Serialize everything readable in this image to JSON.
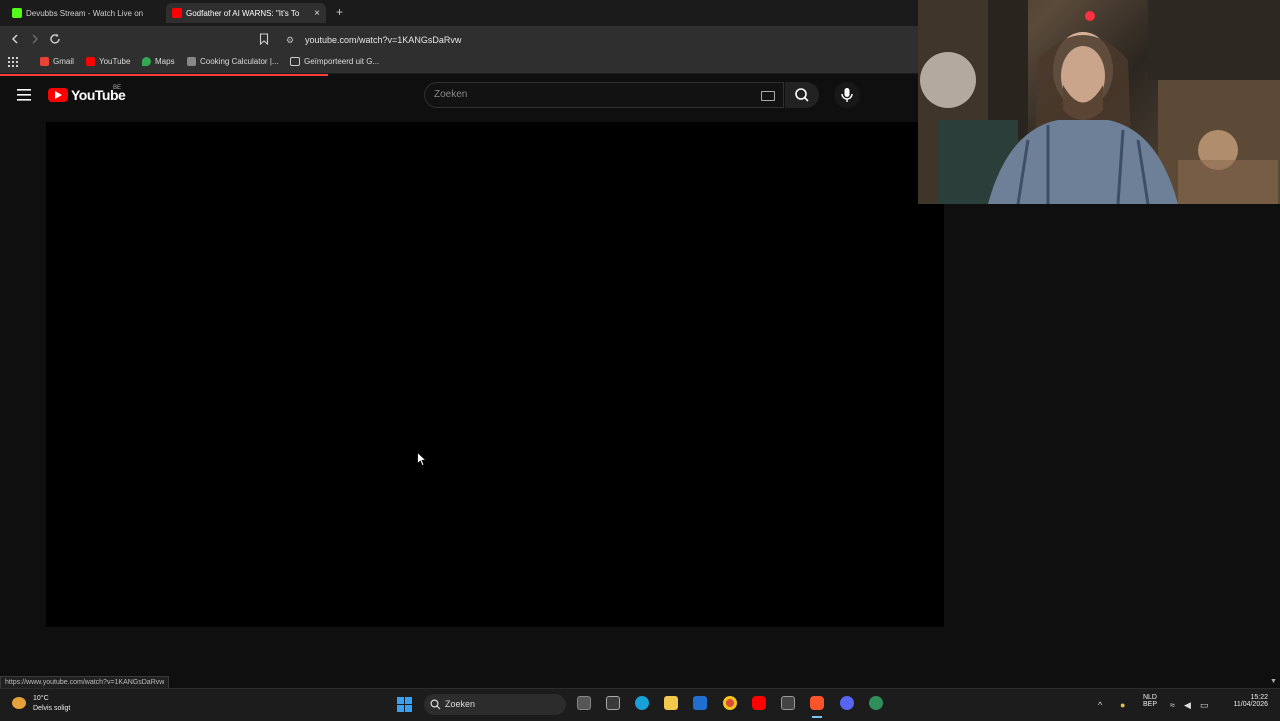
{
  "browser": {
    "tabs": [
      {
        "title": "Devubbs Stream - Watch Live on",
        "active": false,
        "favicon_color": "#53fc18"
      },
      {
        "title": "Godfather of AI WARNS: \"It's To",
        "active": true,
        "favicon_color": "#ff0000"
      }
    ],
    "new_tab": "+",
    "close_tab": "×",
    "url": "youtube.com/watch?v=1KANGsDaRvw",
    "bookmarks": [
      {
        "label": "Gmail",
        "color": "#ea4335"
      },
      {
        "label": "YouTube",
        "color": "#ff0000"
      },
      {
        "label": "Maps",
        "color": "#34a853"
      },
      {
        "label": "Cooking Calculator |...",
        "color": "#888888"
      },
      {
        "label": "Geïmporteerd uit G...",
        "color": "#cccccc"
      }
    ],
    "status_url": "https://www.youtube.com/watch?v=1KANGsDaRvw"
  },
  "youtube": {
    "logo_text": "YouTube",
    "country_code": "BE",
    "search_placeholder": "Zoeken"
  },
  "taskbar": {
    "weather_temp": "10°C",
    "weather_desc": "Delvis soligt",
    "search_label": "Zoeken",
    "lang_top": "NLD",
    "lang_bottom": "BEP",
    "time": "15:22",
    "date": "11/04/2026"
  }
}
